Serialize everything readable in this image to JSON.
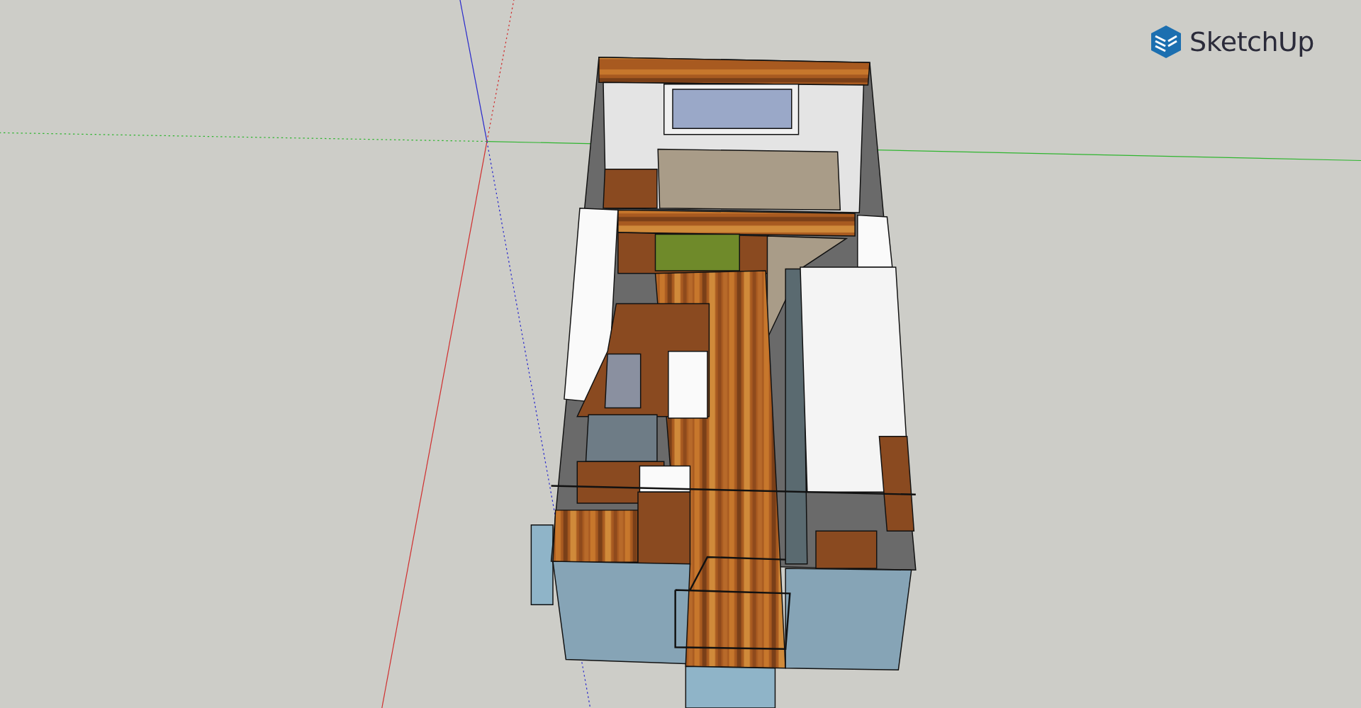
{
  "logo": {
    "text": "SketchUp"
  }
}
